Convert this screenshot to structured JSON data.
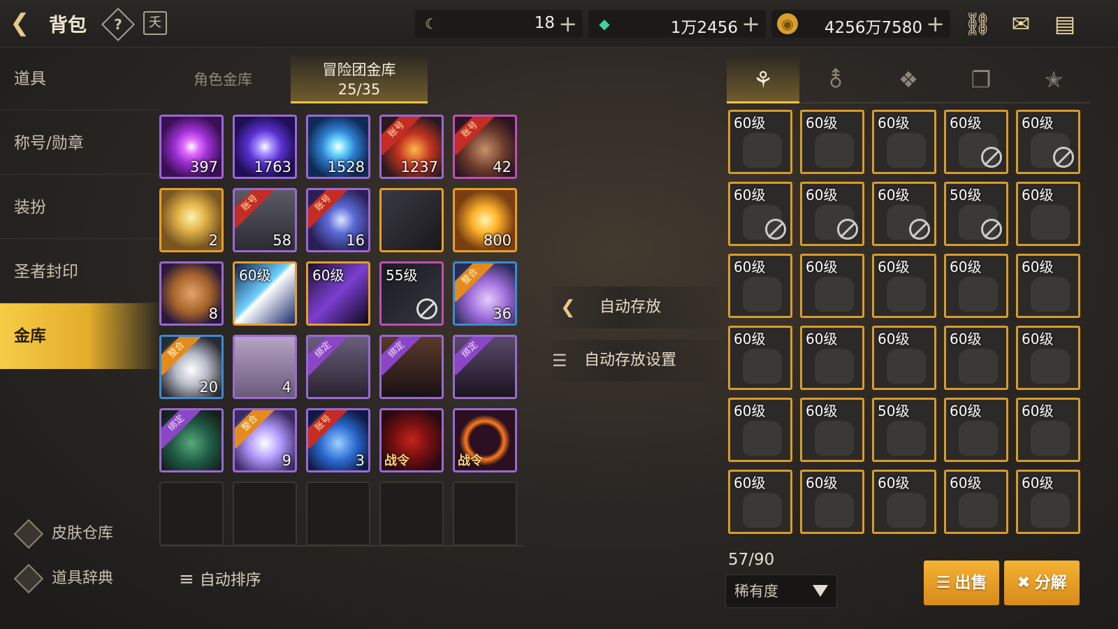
{
  "header": {
    "title": "背包",
    "help_icon": "?",
    "calendar_icon": "夭"
  },
  "resources": [
    {
      "name": "fatigue",
      "icon": "moon-icon",
      "value": "18",
      "plus": "+"
    },
    {
      "name": "gem",
      "icon": "gem-icon",
      "value": "1万2456",
      "plus": "+"
    },
    {
      "name": "gold",
      "icon": "coin-icon",
      "value": "4256万7580",
      "plus": "+"
    }
  ],
  "sidebar": {
    "items": [
      "道具",
      "称号/勋章",
      "装扮",
      "圣者封印",
      "金库"
    ],
    "links": [
      "皮肤仓库",
      "道具辞典"
    ]
  },
  "tabs": {
    "role": "角色金库",
    "adventure": "冒险团金库",
    "adventure_count": "25/35"
  },
  "grid": [
    {
      "count": "397",
      "color": "purple",
      "tag": ""
    },
    {
      "count": "1763",
      "color": "purple",
      "tag": ""
    },
    {
      "count": "1528",
      "color": "purple",
      "tag": ""
    },
    {
      "count": "1237",
      "color": "purple",
      "tag": "账号"
    },
    {
      "count": "42",
      "color": "pink",
      "tag": "账号"
    },
    {
      "count": "2",
      "color": "orange",
      "tag": ""
    },
    {
      "count": "58",
      "color": "purple",
      "tag": "账号"
    },
    {
      "count": "16",
      "color": "purple",
      "tag": "账号"
    },
    {
      "count": "",
      "color": "orange",
      "tag": ""
    },
    {
      "count": "800",
      "color": "orange",
      "tag": ""
    },
    {
      "count": "8",
      "color": "purple",
      "tag": ""
    },
    {
      "level": "60级",
      "count": "",
      "color": "orange",
      "tag": ""
    },
    {
      "level": "60级",
      "count": "",
      "color": "orange",
      "tag": ""
    },
    {
      "level": "55级",
      "count": "",
      "color": "pink",
      "tag": ""
    },
    {
      "count": "36",
      "color": "blue",
      "tag": "整合"
    },
    {
      "count": "20",
      "color": "blue",
      "tag": "整合"
    },
    {
      "count": "4",
      "color": "purple",
      "tag": ""
    },
    {
      "count": "",
      "color": "purple",
      "tag": "绑定"
    },
    {
      "count": "",
      "color": "purple",
      "tag": "绑定"
    },
    {
      "count": "",
      "color": "purple",
      "tag": "绑定"
    },
    {
      "count": "",
      "color": "purple",
      "tag": "绑定"
    },
    {
      "count": "9",
      "color": "purple",
      "tag": "整合"
    },
    {
      "count": "3",
      "color": "purple",
      "tag": "账号"
    },
    {
      "count": "",
      "color": "purple",
      "tag": "",
      "label": "战令"
    },
    {
      "count": "",
      "color": "purple",
      "tag": "",
      "label": "战令"
    }
  ],
  "sort_button": "自动排序",
  "middle": {
    "auto_store": "自动存放",
    "auto_store_settings": "自动存放设置"
  },
  "right_tabs": [
    "armor-icon",
    "potion-icon",
    "cube-icon",
    "cards-icon",
    "star-icon"
  ],
  "equipment": [
    {
      "level": "60级",
      "banned": false
    },
    {
      "level": "60级",
      "banned": false
    },
    {
      "level": "60级",
      "banned": false
    },
    {
      "level": "60级",
      "banned": true
    },
    {
      "level": "60级",
      "banned": true
    },
    {
      "level": "60级",
      "banned": true
    },
    {
      "level": "60级",
      "banned": true
    },
    {
      "level": "60级",
      "banned": true
    },
    {
      "level": "50级",
      "banned": true
    },
    {
      "level": "60级",
      "banned": false
    },
    {
      "level": "60级",
      "banned": false
    },
    {
      "level": "60级",
      "banned": false
    },
    {
      "level": "60级",
      "banned": false
    },
    {
      "level": "60级",
      "banned": false
    },
    {
      "level": "60级",
      "banned": false
    },
    {
      "level": "60级",
      "banned": false
    },
    {
      "level": "60级",
      "banned": false
    },
    {
      "level": "60级",
      "banned": false
    },
    {
      "level": "60级",
      "banned": false
    },
    {
      "level": "60级",
      "banned": false
    },
    {
      "level": "60级",
      "banned": false
    },
    {
      "level": "60级",
      "banned": false
    },
    {
      "level": "50级",
      "banned": false
    },
    {
      "level": "60级",
      "banned": false
    },
    {
      "level": "60级",
      "banned": false
    },
    {
      "level": "60级",
      "banned": false
    },
    {
      "level": "60级",
      "banned": false
    },
    {
      "level": "60级",
      "banned": false
    },
    {
      "level": "60级",
      "banned": false
    },
    {
      "level": "60级",
      "banned": false
    }
  ],
  "capacity": "57/90",
  "filter": {
    "rarity": "稀有度"
  },
  "actions": {
    "sell": "出售",
    "decompose": "分解"
  },
  "colors": {
    "accent": "#f2c24a",
    "purple": "#9a6ad1",
    "orange": "#e69f2b",
    "blue": "#3d8bd4"
  }
}
